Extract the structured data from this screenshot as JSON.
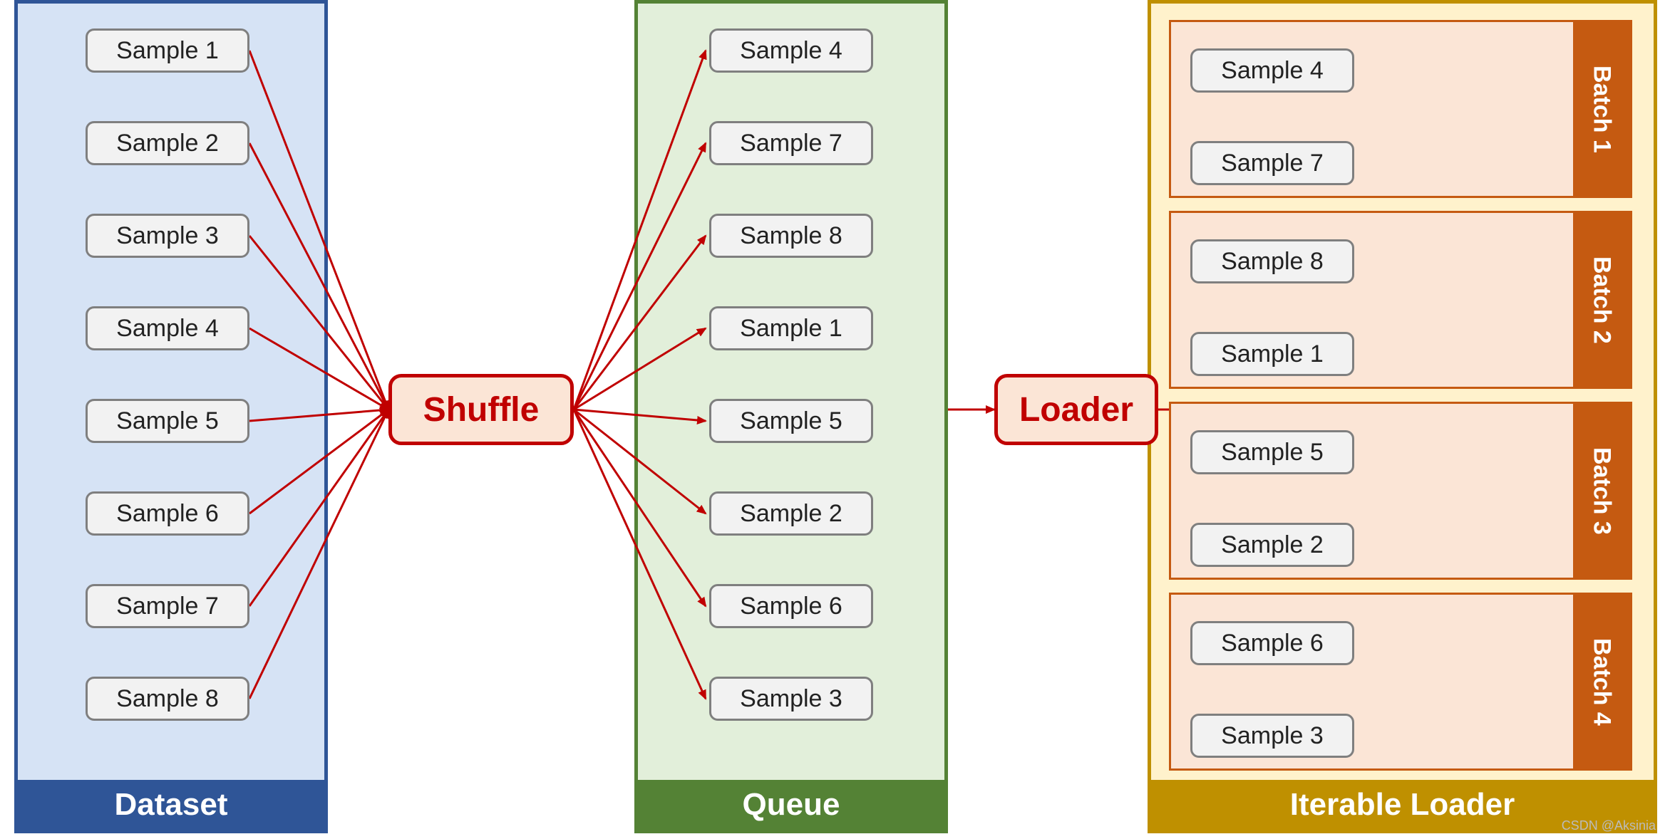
{
  "columns": {
    "dataset": "Dataset",
    "queue": "Queue",
    "loader": "Iterable Loader"
  },
  "ops": {
    "shuffle": "Shuffle",
    "loader": "Loader"
  },
  "dataset_samples": [
    "Sample 1",
    "Sample 2",
    "Sample 3",
    "Sample 4",
    "Sample 5",
    "Sample 6",
    "Sample 7",
    "Sample 8"
  ],
  "queue_samples": [
    "Sample 4",
    "Sample 7",
    "Sample 8",
    "Sample 1",
    "Sample 5",
    "Sample 2",
    "Sample 6",
    "Sample 3"
  ],
  "batches": [
    {
      "name": "Batch 1",
      "items": [
        "Sample 4",
        "Sample 7"
      ]
    },
    {
      "name": "Batch 2",
      "items": [
        "Sample 8",
        "Sample 1"
      ]
    },
    {
      "name": "Batch 3",
      "items": [
        "Sample 5",
        "Sample 2"
      ]
    },
    {
      "name": "Batch 4",
      "items": [
        "Sample 6",
        "Sample 3"
      ]
    }
  ],
  "shuffle_map": [
    3,
    6,
    7,
    0,
    4,
    1,
    5,
    2
  ],
  "colors": {
    "arrow": "#c00000",
    "dataset_border": "#2f5597",
    "queue_border": "#548235",
    "loader_border": "#bf9000",
    "batch_border": "#c55a11"
  },
  "watermark": "CSDN @Aksinia"
}
